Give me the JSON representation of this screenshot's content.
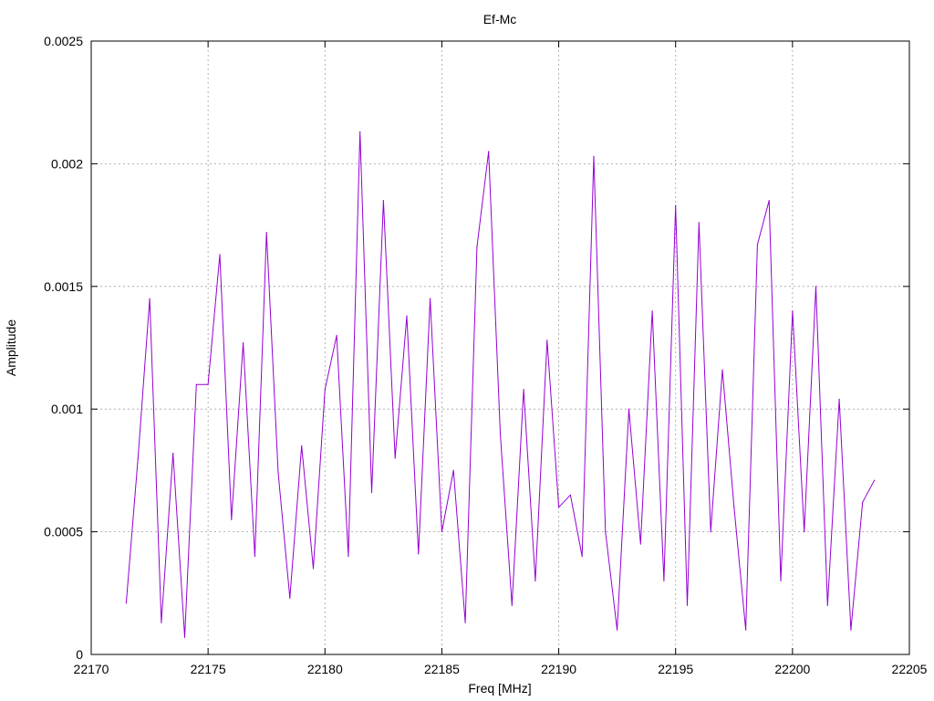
{
  "chart_data": {
    "type": "line",
    "title": "Ef-Mc",
    "xlabel": "Freq [MHz]",
    "ylabel": "Amplitude",
    "xlim": [
      22170,
      22205
    ],
    "ylim": [
      0,
      0.0025
    ],
    "x_ticks": [
      "22170",
      "22175",
      "22180",
      "22185",
      "22190",
      "22195",
      "22200",
      "22205"
    ],
    "y_ticks": [
      "0",
      "0.0005",
      "0.001",
      "0.0015",
      "0.002",
      "0.0025"
    ],
    "grid": true,
    "legend": "none",
    "line_color": "#9400d3",
    "series": [
      {
        "x": [
          22171.5,
          22172.0,
          22172.5,
          22173.0,
          22173.5,
          22174.0,
          22174.5,
          22175.0,
          22175.5,
          22176.0,
          22176.5,
          22177.0,
          22177.5,
          22178.0,
          22178.5,
          22179.0,
          22179.5,
          22180.0,
          22180.5,
          22181.0,
          22181.5,
          22182.0,
          22182.5,
          22183.0,
          22183.5,
          22184.0,
          22184.5,
          22185.0,
          22185.5,
          22186.0,
          22186.5,
          22187.0,
          22187.5,
          22188.0,
          22188.5,
          22189.0,
          22189.5,
          22190.0,
          22190.5,
          22191.0,
          22191.5,
          22192.0,
          22192.5,
          22193.0,
          22193.5,
          22194.0,
          22194.5,
          22195.0,
          22195.5,
          22196.0,
          22196.5,
          22197.0,
          22197.5,
          22198.0,
          22198.5,
          22199.0,
          22199.5,
          22200.0,
          22200.5,
          22201.0,
          22201.5,
          22202.0,
          22202.5,
          22203.0,
          22203.5
        ],
        "values": [
          0.00021,
          0.0008,
          0.00145,
          0.00013,
          0.00082,
          7e-05,
          0.0011,
          0.0011,
          0.00163,
          0.00055,
          0.00127,
          0.0004,
          0.00172,
          0.00074,
          0.00023,
          0.00085,
          0.00035,
          0.00108,
          0.0013,
          0.0004,
          0.00213,
          0.00066,
          0.00185,
          0.0008,
          0.00138,
          0.00041,
          0.00145,
          0.0005,
          0.00075,
          0.00013,
          0.00166,
          0.00205,
          0.0009,
          0.0002,
          0.00108,
          0.0003,
          0.00128,
          0.0006,
          0.00065,
          0.0004,
          0.00203,
          0.0005,
          0.0001,
          0.001,
          0.00045,
          0.0014,
          0.0003,
          0.00183,
          0.0002,
          0.00176,
          0.0005,
          0.00116,
          0.0006,
          0.0001,
          0.00167,
          0.00185,
          0.0003,
          0.0014,
          0.0005,
          0.0015,
          0.0002,
          0.00104,
          0.0001,
          0.00062,
          0.00071
        ]
      }
    ]
  }
}
